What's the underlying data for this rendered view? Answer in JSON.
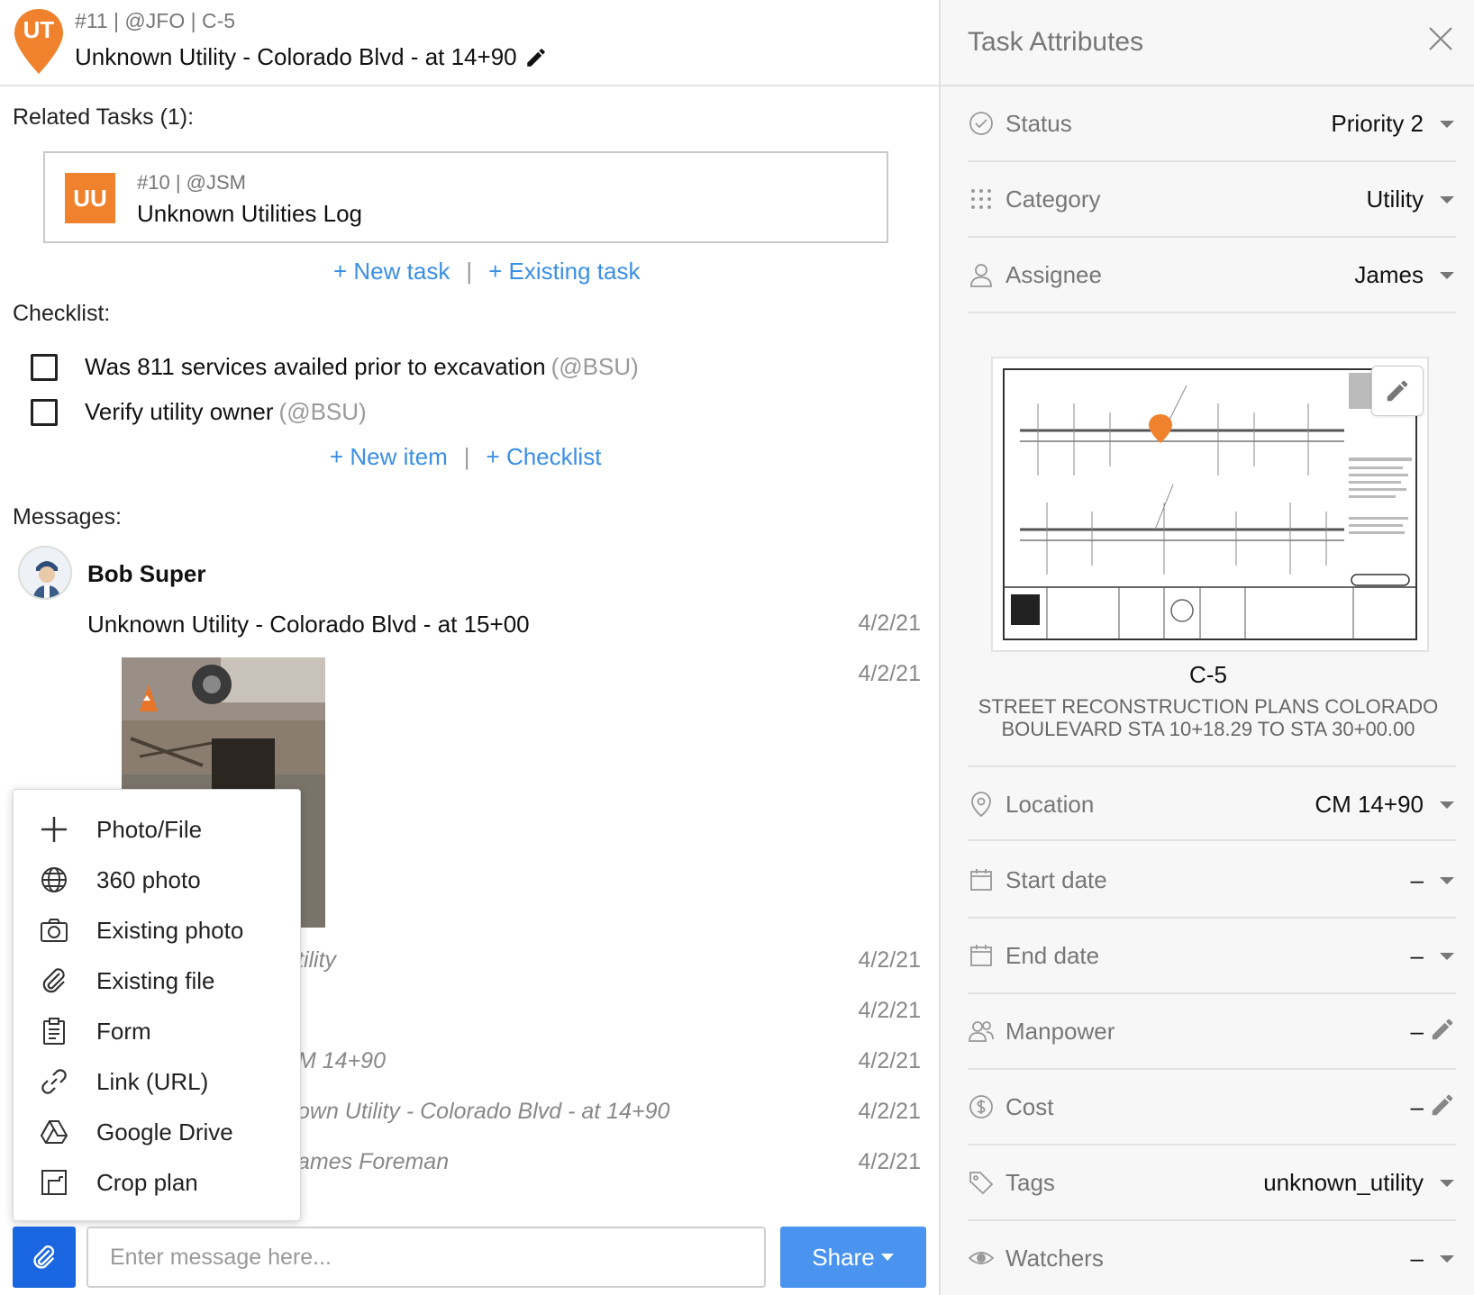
{
  "header": {
    "badge": "UT",
    "meta": "#11 | @JFO | C-5",
    "title": "Unknown Utility - Colorado Blvd - at 14+90"
  },
  "related": {
    "label": "Related Tasks (1):",
    "task": {
      "badge": "UU",
      "meta": "#10 | @JSM",
      "title": "Unknown Utilities Log"
    },
    "new_task": "+ New task",
    "existing_task": "+ Existing task",
    "separator": "|"
  },
  "checklist": {
    "label": "Checklist:",
    "items": [
      {
        "text": "Was 811 services availed prior to excavation",
        "mention": "(@BSU)",
        "checked": false
      },
      {
        "text": "Verify utility owner",
        "mention": "(@BSU)",
        "checked": false
      }
    ],
    "new_item": "+ New item",
    "add_checklist": "+ Checklist"
  },
  "messages": {
    "label": "Messages:",
    "author": "Bob Super",
    "entries": [
      {
        "text": "Unknown Utility - Colorado Blvd - at 15+00",
        "date": "4/2/21"
      },
      {
        "text": "",
        "date": "4/2/21"
      },
      {
        "text": "tility",
        "date": "4/2/21"
      },
      {
        "text": "",
        "date": "4/2/21"
      },
      {
        "text": "M 14+90",
        "date": "4/2/21"
      },
      {
        "text": "own Utility - Colorado Blvd - at 14+90",
        "date": "4/2/21"
      },
      {
        "text": "ames Foreman",
        "date": "4/2/21"
      }
    ]
  },
  "attach_menu": {
    "items": [
      {
        "label": "Photo/File",
        "icon": "plus-icon"
      },
      {
        "label": "360 photo",
        "icon": "globe-icon"
      },
      {
        "label": "Existing photo",
        "icon": "camera-icon"
      },
      {
        "label": "Existing file",
        "icon": "paperclip-icon"
      },
      {
        "label": "Form",
        "icon": "clipboard-icon"
      },
      {
        "label": "Link (URL)",
        "icon": "link-icon"
      },
      {
        "label": "Google Drive",
        "icon": "google-drive-icon"
      },
      {
        "label": "Crop plan",
        "icon": "crop-icon"
      }
    ]
  },
  "composer": {
    "placeholder": "Enter message here...",
    "share_label": "Share"
  },
  "attributes": {
    "title": "Task Attributes",
    "status": {
      "label": "Status",
      "value": "Priority 2"
    },
    "category": {
      "label": "Category",
      "value": "Utility"
    },
    "assignee": {
      "label": "Assignee",
      "value": "James"
    },
    "plan": {
      "code": "C-5",
      "description": "STREET RECONSTRUCTION PLANS COLORADO BOULEVARD STA 10+18.29 TO STA 30+00.00"
    },
    "location": {
      "label": "Location",
      "value": "CM 14+90"
    },
    "start_date": {
      "label": "Start date",
      "value": "–"
    },
    "end_date": {
      "label": "End date",
      "value": "–"
    },
    "manpower": {
      "label": "Manpower",
      "value": "–"
    },
    "cost": {
      "label": "Cost",
      "value": "–"
    },
    "tags": {
      "label": "Tags",
      "value": "unknown_utility"
    },
    "watchers": {
      "label": "Watchers",
      "value": "–"
    }
  },
  "colors": {
    "brand_orange": "#f0822e",
    "link_blue": "#3a8fe6",
    "primary_blue": "#1a66e0",
    "share_blue": "#4a94f0"
  }
}
